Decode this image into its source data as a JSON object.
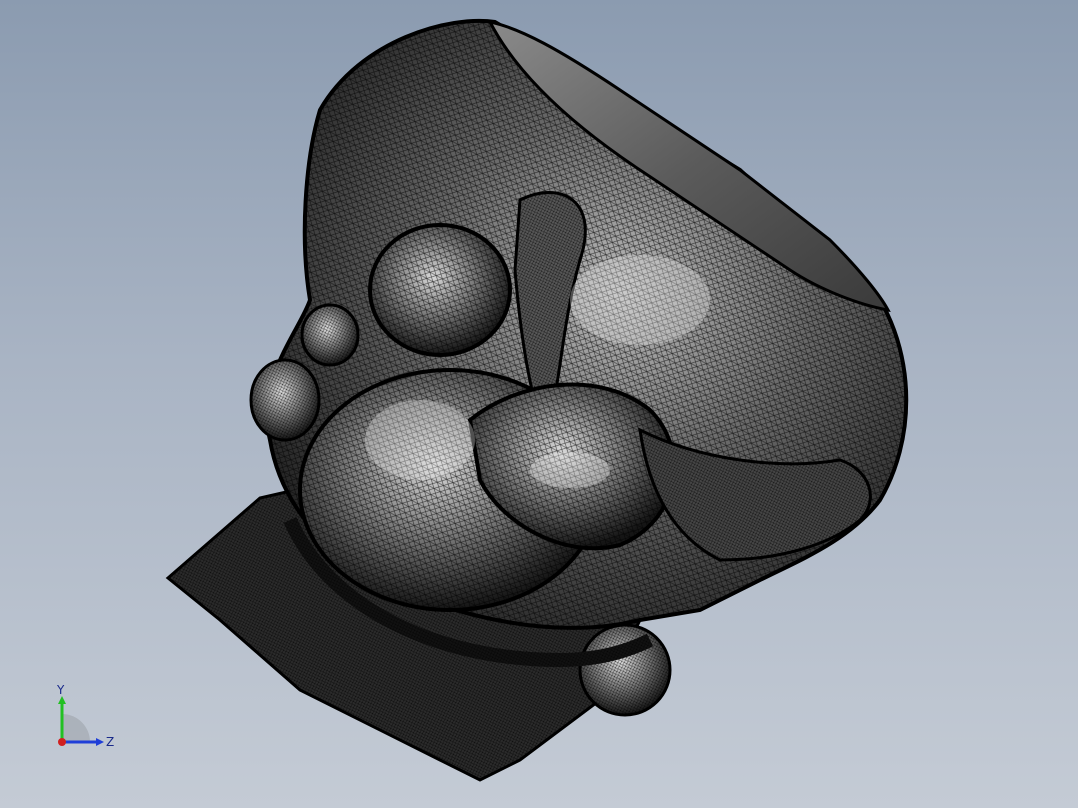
{
  "viewport": {
    "background_top": "#8b9bb0",
    "background_bottom": "#c4cbd5"
  },
  "model": {
    "fill_color": "#3a3a3a",
    "mesh_color": "#000000",
    "highlight_color": "#cfcfcf"
  },
  "triad": {
    "y_label": "Y",
    "z_label": "Z",
    "y_color": "#22c022",
    "z_color": "#1f3fd8",
    "x_color": "#d02020"
  }
}
